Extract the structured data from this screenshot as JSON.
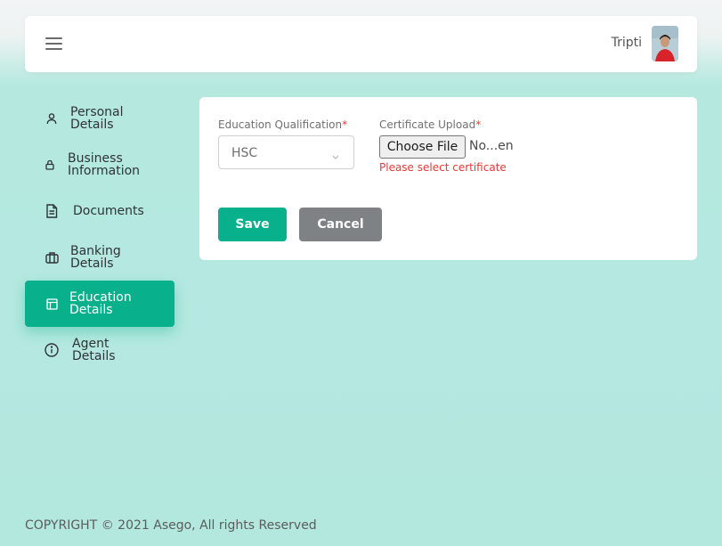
{
  "header": {
    "user_name": "Tripti"
  },
  "sidebar": {
    "items": [
      {
        "label": "Personal\nDetails",
        "icon": "user-icon",
        "active": false
      },
      {
        "label": "Business\nInformation",
        "icon": "lock-icon",
        "active": false
      },
      {
        "label": "Documents",
        "icon": "document-icon",
        "active": false
      },
      {
        "label": "Banking\nDetails",
        "icon": "briefcase-icon",
        "active": false
      },
      {
        "label": "Education\nDetails",
        "icon": "layout-icon",
        "active": true
      },
      {
        "label": "Agent\nDetails",
        "icon": "info-icon",
        "active": false
      }
    ]
  },
  "form": {
    "qualification_label": "Education Qualification",
    "qualification_value": "HSC",
    "certificate_label": "Certificate Upload",
    "required_mark": "*",
    "file_button_label": "Choose File",
    "file_status": "No...en",
    "error_text": "Please select certificate",
    "save_label": "Save",
    "cancel_label": "Cancel"
  },
  "footer": {
    "copyright": "COPYRIGHT © 2021 Asego, All rights Reserved"
  },
  "colors": {
    "accent": "#08b08c",
    "background": "#b3e8df",
    "error": "#e53935",
    "cancel": "#7e8285"
  }
}
